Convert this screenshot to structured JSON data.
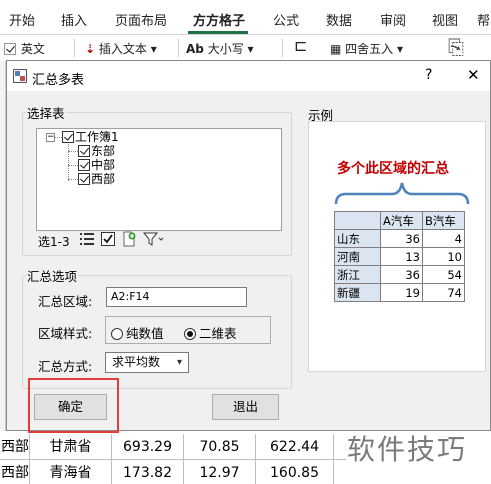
{
  "ribbon": {
    "tabs": [
      "开始",
      "插入",
      "页面布局",
      "方方格子",
      "公式",
      "数据",
      "审阅",
      "视图",
      "帮"
    ],
    "active_tab": "方方格子",
    "tools": {
      "english": "英文",
      "insert_text": "插入文本",
      "case": "大小写",
      "case_prefix": "Ab",
      "round": "四舍五入"
    }
  },
  "sheet": {
    "rows": [
      {
        "a": "西部",
        "b": "甘肃省",
        "c": "693.29",
        "d": "70.85",
        "e": "622.44"
      },
      {
        "a": "西部",
        "b": "青海省",
        "c": "173.82",
        "d": "12.97",
        "e": "160.85"
      }
    ]
  },
  "watermark": "软件技巧",
  "dialog": {
    "title": "汇总多表",
    "help": "?",
    "close": "✕",
    "select_table": {
      "label": "选择表",
      "tree": {
        "root": "工作簿1",
        "children": [
          "东部",
          "中部",
          "西部"
        ]
      },
      "selection_count": "选1-3"
    },
    "options": {
      "label": "汇总选项",
      "range_label": "汇总区域:",
      "range_value": "A2:F14",
      "style_label": "区域样式:",
      "style_options": [
        "纯数值",
        "二维表"
      ],
      "style_selected": "二维表",
      "method_label": "汇总方式:",
      "method_value": "求平均数"
    },
    "ok_button": "确定",
    "exit_button": "退出",
    "example": {
      "label": "示例",
      "caption": "多个此区域的汇总",
      "headers": [
        "",
        "A汽车",
        "B汽车"
      ],
      "rows": [
        {
          "name": "山东",
          "a": "36",
          "b": "4"
        },
        {
          "name": "河南",
          "a": "13",
          "b": "10"
        },
        {
          "name": "浙江",
          "a": "36",
          "b": "54"
        },
        {
          "name": "新疆",
          "a": "19",
          "b": "74"
        }
      ]
    }
  },
  "colors": {
    "excel_green": "#217346",
    "highlight_red": "#e23c3c",
    "caption_red": "#c00000",
    "brace_blue": "#4f81bd"
  }
}
